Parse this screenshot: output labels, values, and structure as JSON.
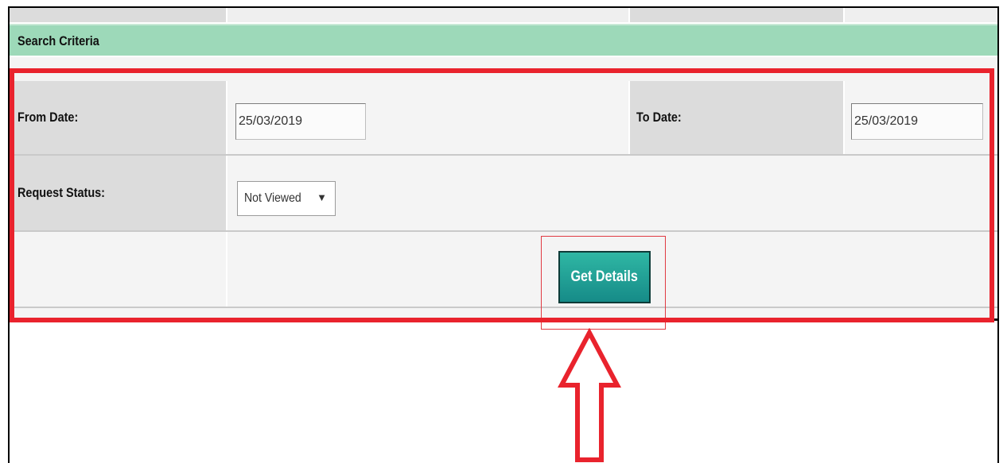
{
  "header": {
    "title": "Search Criteria"
  },
  "form": {
    "from_date_label": "From Date:",
    "from_date_value": "25/03/2019",
    "to_date_label": "To Date:",
    "to_date_value": "25/03/2019",
    "status_label": "Request Status:",
    "status_value": "Not Viewed",
    "status_chevron": "▼"
  },
  "actions": {
    "get_details_label": "Get Details"
  },
  "annotations": {
    "highlight_color": "#e9232d",
    "arrow_icon": "up-arrow-icon"
  },
  "colors": {
    "header_bg": "#9dd9b9",
    "button_bg": "#1a9a92"
  }
}
